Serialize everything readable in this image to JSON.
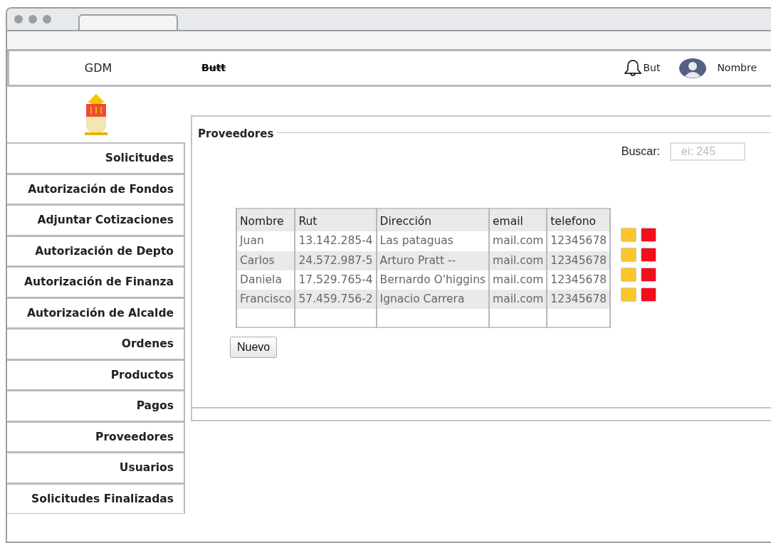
{
  "header": {
    "brand": "GDM",
    "button_label": "Butt",
    "bell_label": "But",
    "user_name": "Nombre"
  },
  "sidebar": {
    "items": [
      {
        "label": "Solicitudes"
      },
      {
        "label": "Autorización de Fondos"
      },
      {
        "label": "Adjuntar Cotizaciones"
      },
      {
        "label": "Autorización de Depto"
      },
      {
        "label": "Autorización de Finanza"
      },
      {
        "label": "Autorización de Alcalde"
      },
      {
        "label": "Ordenes"
      },
      {
        "label": "Productos"
      },
      {
        "label": "Pagos"
      },
      {
        "label": "Proveedores"
      },
      {
        "label": "Usuarios"
      },
      {
        "label": "Solicitudes Finalizadas"
      }
    ]
  },
  "panel": {
    "title": "Proveedores",
    "search": {
      "label": "Buscar:",
      "placeholder": "ei: 245"
    },
    "table": {
      "columns": [
        "Nombre",
        "Rut",
        "Dirección",
        "email",
        "telefono"
      ],
      "rows": [
        [
          "Juan",
          "13.142.285-4",
          "Las pataguas",
          "mail.com",
          "12345678"
        ],
        [
          "Carlos",
          "24.572.987-5",
          "Arturo Pratt  --",
          "mail.com",
          "12345678"
        ],
        [
          "Daniela",
          "17.529.765-4",
          "Bernardo O'higgins",
          "mail.com",
          "12345678"
        ],
        [
          "Francisco",
          "57.459.756-2",
          "Ignacio Carrera",
          "mail.com",
          "12345678"
        ]
      ]
    },
    "new_button": "Nuevo"
  }
}
